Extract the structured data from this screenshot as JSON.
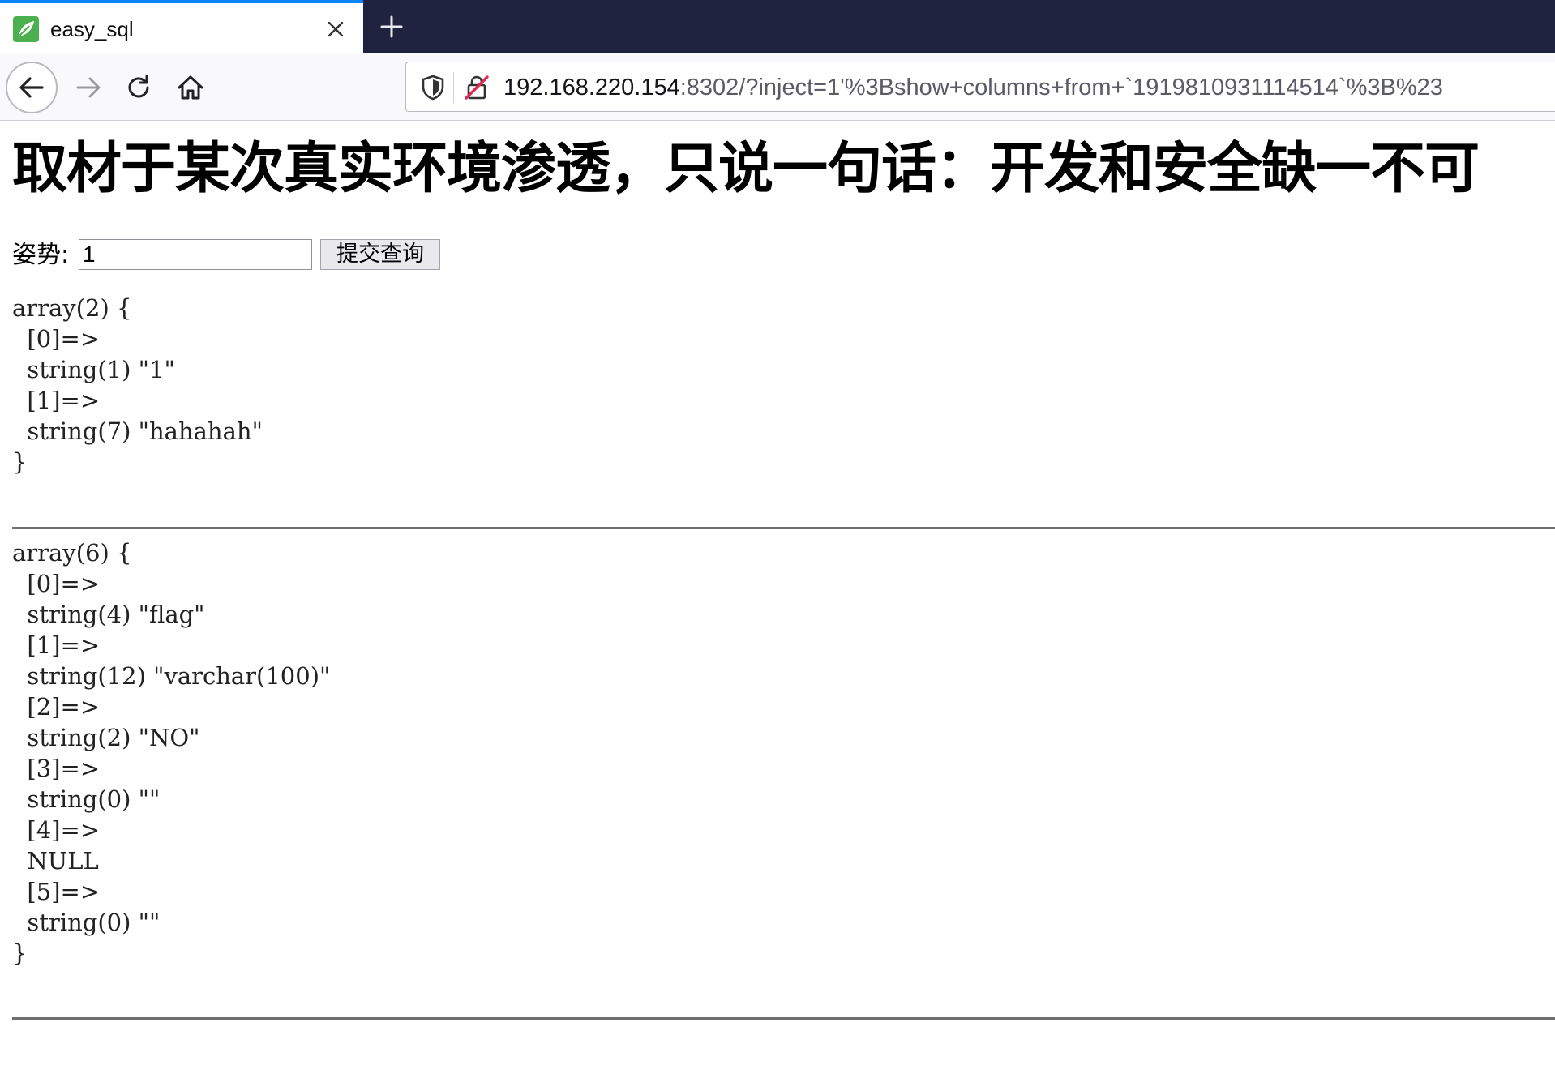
{
  "browser": {
    "tab": {
      "title": "easy_sql"
    },
    "url": {
      "host": "192.168.220.154",
      "rest": ":8302/?inject=1'%3Bshow+columns+from+`1919810931114514`%3B%23"
    },
    "colors": {
      "tabstrip": "#1f2340",
      "active_tab_accent": "#0a84ff"
    },
    "icons": {
      "favicon": "leaf-favicon-icon",
      "close": "close-icon",
      "new_tab": "plus-icon",
      "back": "arrow-left-icon",
      "forward": "arrow-right-icon",
      "reload": "reload-icon",
      "home": "home-icon",
      "tracking": "shield-icon",
      "insecure": "insecure-lock-icon"
    }
  },
  "page": {
    "heading": "取材于某次真实环境渗透，只说一句话：开发和安全缺一不可",
    "form": {
      "label": "姿势:",
      "input_value": "1",
      "submit_label": "提交查询"
    },
    "results": [
      "array(2) {\n  [0]=>\n  string(1) \"1\"\n  [1]=>\n  string(7) \"hahahah\"\n}",
      "array(6) {\n  [0]=>\n  string(4) \"flag\"\n  [1]=>\n  string(12) \"varchar(100)\"\n  [2]=>\n  string(2) \"NO\"\n  [3]=>\n  string(0) \"\"\n  [4]=>\n  NULL\n  [5]=>\n  string(0) \"\"\n}"
    ]
  }
}
